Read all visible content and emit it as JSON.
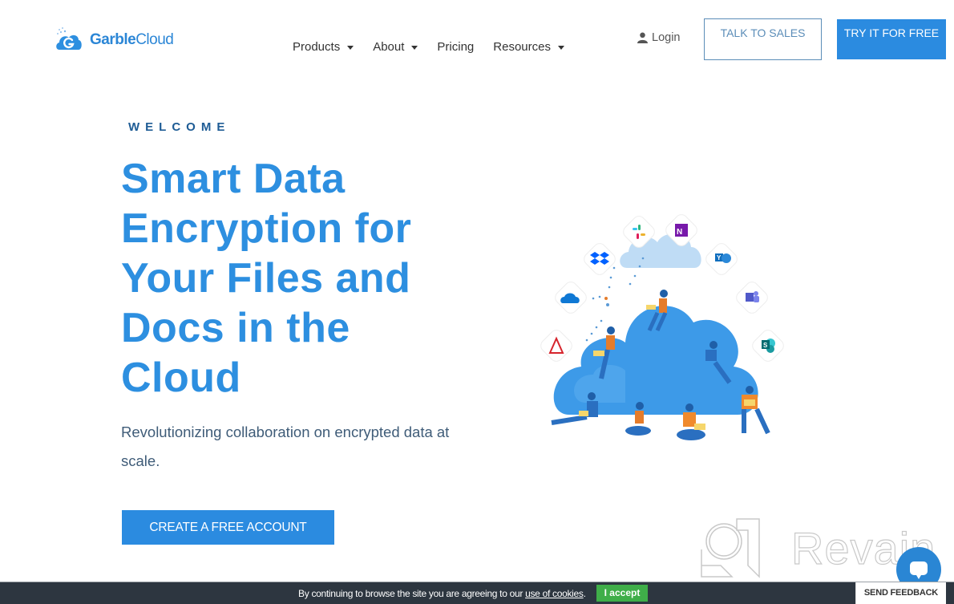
{
  "brand": {
    "name_bold": "Garble",
    "name_light": "Cloud",
    "primary_color": "#2b8be0",
    "logo_icon": "cloud-g-logo-icon"
  },
  "nav": {
    "items": [
      {
        "label": "Products",
        "has_dropdown": true
      },
      {
        "label": "About",
        "has_dropdown": true
      },
      {
        "label": "Pricing",
        "has_dropdown": false
      },
      {
        "label": "Resources",
        "has_dropdown": true
      }
    ],
    "login_label": "Login",
    "login_icon": "user-icon",
    "talk_to_sales_label": "TALK TO SALES",
    "try_free_label": "TRY IT FOR FREE"
  },
  "hero": {
    "eyebrow": "WELCOME",
    "headline": "Smart Data Encryption for Your Files and Docs in the Cloud",
    "subtitle": "Revolutionizing collaboration on encrypted data at scale.",
    "cta_label": "CREATE A FREE ACCOUNT",
    "illustration": {
      "description": "People working on laptops around a large blue cloud",
      "integration_icons": [
        "slack-icon",
        "onenote-icon",
        "dropbox-icon",
        "yammer-icon",
        "onedrive-icon",
        "teams-icon",
        "acrobat-icon",
        "sharepoint-icon"
      ]
    }
  },
  "watermark": {
    "text": "Revain"
  },
  "cookie_bar": {
    "text_prefix": "By continuing to browse the site you are agreeing to our ",
    "link_text": "use of cookies",
    "text_suffix": ".",
    "accept_label": "I accept",
    "accept_color": "#3fae49"
  },
  "feedback": {
    "label": "SEND FEEDBACK",
    "chat_icon": "chat-icon"
  }
}
